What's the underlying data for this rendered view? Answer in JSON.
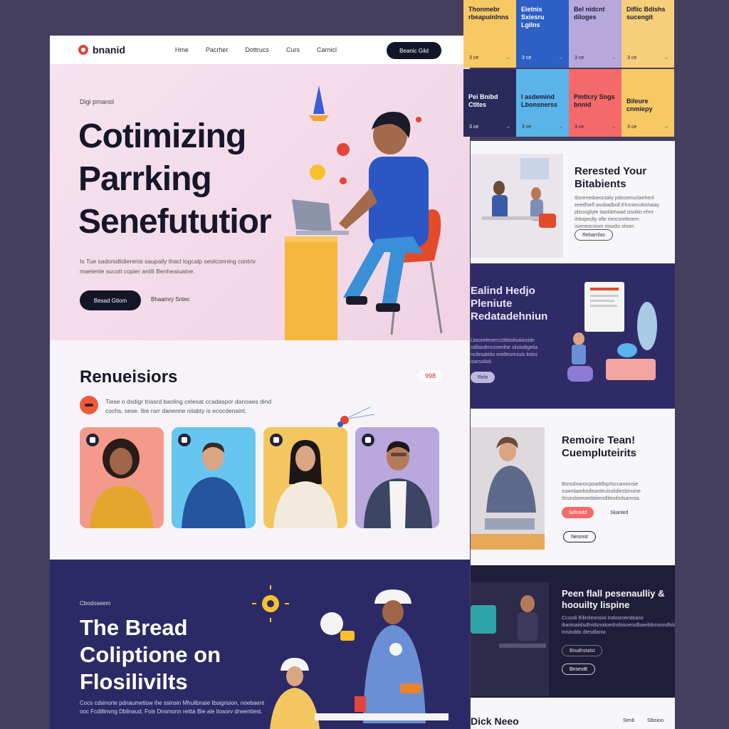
{
  "nav": {
    "brand": "bnanid",
    "links": [
      "Hme",
      "Pacrher",
      "Dottrucs",
      "Curs",
      "Carnicl"
    ],
    "cta": "Beanic Gild"
  },
  "hero": {
    "eyebrow": "Digi prnanol",
    "title": "Cotimizing Parrking Senefututior",
    "description": "Is Tue sadonidlidierenis saupaily thacl logcalp seolconning contriv maeienle sucott copier antili Benheaiuaine.",
    "primary_button": "Besad Gtiom",
    "secondary_link": "Bhaamry Sntec"
  },
  "resources": {
    "title": "Renueisiors",
    "badge": "998",
    "description": "Tiese o dsdigr triasrd baoling celesat ccadaspor danoaes dind cochs, sese. Ibe rarr danenne niiabty is ecocdenaint."
  },
  "bottom": {
    "tag": "Cbodoseem",
    "title": "The Bread Coliptione on Flosilivilts",
    "description": "Cocs cdsinorte pdnaumetiow ihe ssinsin Mhulibnaie Ibsigrision, noebaent ooc Fcdillinvng Dblinaud, Fois Dnsmonn reitta Bie ale itosorv dneentiest."
  },
  "tiles": [
    {
      "label": "Thonmebr rbeapuinlnns",
      "bg": "#f7c964",
      "fg": "#1c1c30"
    },
    {
      "label": "Eietnis Sxiesru Lgilns",
      "bg": "#2d5fc4",
      "fg": "#ffffff"
    },
    {
      "label": "Bel nidcnt diloges",
      "bg": "#b7a8dc",
      "fg": "#1c1c30"
    },
    {
      "label": "Diflic Bdishs sucengit",
      "bg": "#f7cf7a",
      "fg": "#1c1c30"
    },
    {
      "label": "Pei Bnibd Ctltes",
      "bg": "#2a2a5c",
      "fg": "#ffffff"
    },
    {
      "label": "I asdemind Lbonsnerss",
      "bg": "#5ab4ea",
      "fg": "#1c1c30"
    },
    {
      "label": "Pmtlcry Sngs bnnid",
      "bg": "#f46a6a",
      "fg": "#1c1c30"
    },
    {
      "label": "Bileure cnmiepy",
      "bg": "#f7c964",
      "fg": "#1c1c30"
    }
  ],
  "tile_foot": "3 ce",
  "sections": {
    "s1": {
      "title": "Rerested Your Bitabients",
      "description": "Ibsrenedoeoctaliy pdocemuclaehenl eeetlhiefl asobadboll Ehnniecobshaiay plisssgliyle tiaoldehaad sisoltio efmt ihbopeslty ofle riencsreleoem isieneocsiom eisodsi eloon.",
      "button": "Rebarrilas"
    },
    "s2": {
      "title": "Ealind Hedjo Pleniute Redatadehniun",
      "description": "Lbsoreleoerccddoolisaiiosidn sdilaodmcosenihe slisiodtgelia ncilesalelio ieielleoriniuis ilstos isarsolioli.",
      "button": "Rele"
    },
    "s3": {
      "title": "Remoire Tean! Cuempluteirits",
      "description": "Bsnsdnanocpoaddlsprlscuaoisnsie suwnlaanbodisanleuisolidiesbinuine Ilssindseeoeddiiieodlileoilsdsamnia.",
      "button": "Sdhsidd",
      "link": "Skanled",
      "outline_button": "Nesmst"
    },
    "s4": {
      "title": "Peen flall pesenaulliy & hoouilty lispine",
      "description": "Ccsodi Eiliroleonsioi Indosroendoaso ibanioaiidsdlnidsnoiioedndsisoeisdbaeiildsnoondlsldosilos lnisioddo dtesdlanio.",
      "button": "Bisalhstalst",
      "outline_button": "Bnsestlt"
    },
    "s5": {
      "title": "Dick Neeo",
      "badges": [
        "Senb",
        "Slbsioo"
      ]
    }
  }
}
